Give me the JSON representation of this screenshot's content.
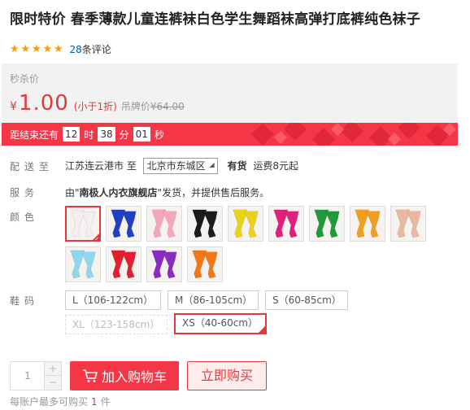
{
  "product": {
    "title": "限时特价 春季薄款儿童连裤袜白色学生舞蹈袜高弹打底裤纯色袜子"
  },
  "rating": {
    "stars": 5,
    "review_count": "28",
    "review_suffix": "条评论"
  },
  "price": {
    "label": "秒杀价",
    "currency": "¥",
    "value": "1.00",
    "discount": "(小于1折)",
    "original_label": "吊牌价",
    "original_price": "¥64.00"
  },
  "countdown": {
    "label": "距结束还有",
    "hours": "12",
    "hours_unit": "时",
    "minutes": "38",
    "minutes_unit": "分",
    "seconds": "01",
    "seconds_unit": "秒"
  },
  "delivery": {
    "label": "配送至",
    "from": "江苏连云港市 至",
    "to_region": "北京市东城区",
    "stock": "有货",
    "shipping": "运费8元起"
  },
  "service": {
    "label": "服务",
    "prefix": "由\"",
    "shop": "南极人内衣旗舰店",
    "suffix": "\"发货，并提供售后服务。"
  },
  "color": {
    "label": "颜色",
    "selected_index": 0,
    "swatches": [
      {
        "name": "white",
        "hex": "#f4eef0"
      },
      {
        "name": "royal-blue",
        "hex": "#1f3fc4"
      },
      {
        "name": "light-pink",
        "hex": "#f3a6bc"
      },
      {
        "name": "black",
        "hex": "#1c1c1c"
      },
      {
        "name": "yellow",
        "hex": "#e8d21a"
      },
      {
        "name": "rose",
        "hex": "#e0207a"
      },
      {
        "name": "green",
        "hex": "#1f9a3a"
      },
      {
        "name": "orange-yellow",
        "hex": "#f0a020"
      },
      {
        "name": "flesh",
        "hex": "#e8b8a0"
      },
      {
        "name": "sky-blue",
        "hex": "#8fd6ee"
      },
      {
        "name": "red",
        "hex": "#e02030"
      },
      {
        "name": "purple",
        "hex": "#8a2bc0"
      },
      {
        "name": "orange",
        "hex": "#f07818"
      }
    ]
  },
  "size": {
    "label": "鞋码",
    "options": [
      {
        "label": "L（106-122cm）",
        "state": "normal"
      },
      {
        "label": "M（86-105cm）",
        "state": "normal"
      },
      {
        "label": "S（60-85cm）",
        "state": "normal"
      },
      {
        "label": "XL（123-158cm）",
        "state": "disabled"
      },
      {
        "label": "XS（40-60cm）",
        "state": "selected"
      }
    ]
  },
  "purchase": {
    "quantity": "1",
    "plus": "+",
    "minus": "−",
    "add_to_cart": "加入购物车",
    "buy_now": "立即购买",
    "limit_prefix": "每账户最多可购买",
    "limit_num": "1",
    "limit_suffix": "件"
  },
  "colors": {
    "accent": "#e4393c",
    "countdown_bg": "#f53647",
    "price_bg": "#f2f2f2",
    "link": "#005ea7",
    "star": "#ff9900"
  }
}
